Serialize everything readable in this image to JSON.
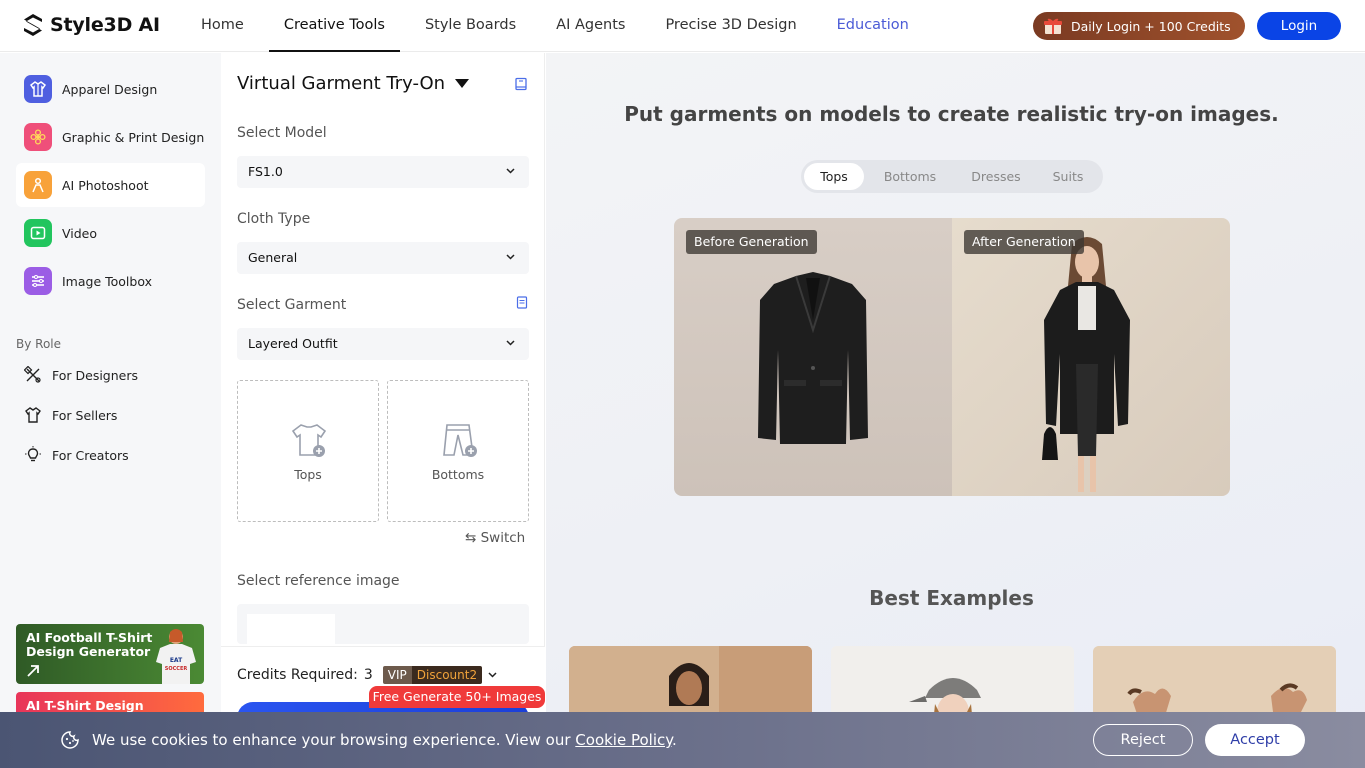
{
  "brand": {
    "name": "Style3D AI"
  },
  "nav": {
    "items": [
      {
        "label": "Home"
      },
      {
        "label": "Creative Tools"
      },
      {
        "label": "Style Boards"
      },
      {
        "label": "AI Agents"
      },
      {
        "label": "Precise 3D Design"
      },
      {
        "label": "Education"
      }
    ],
    "active": "Creative Tools",
    "daily_login": "Daily Login + 100 Credits",
    "login": "Login"
  },
  "sidebar": {
    "items": [
      {
        "label": "Apparel Design",
        "icon": "apparel-icon"
      },
      {
        "label": "Graphic & Print Design",
        "icon": "flower-icon"
      },
      {
        "label": "AI Photoshoot",
        "icon": "person-icon"
      },
      {
        "label": "Video",
        "icon": "video-play-icon"
      },
      {
        "label": "Image Toolbox",
        "icon": "toolbox-icon"
      }
    ],
    "active": "AI Photoshoot",
    "role_heading": "By Role",
    "roles": [
      {
        "label": "For Designers",
        "icon": "design-tools-icon"
      },
      {
        "label": "For Sellers",
        "icon": "shirt-icon"
      },
      {
        "label": "For Creators",
        "icon": "lightbulb-icon"
      }
    ],
    "promos": [
      {
        "label": "AI Football T-Shirt Design Generator",
        "shirt_text": "EAT SLEEP SOCCER REPEAT"
      },
      {
        "label": "AI T-Shirt Design"
      }
    ]
  },
  "panel": {
    "title": "Virtual Garment Try-On",
    "select_model_label": "Select Model",
    "select_model_value": "FS1.0",
    "cloth_type_label": "Cloth Type",
    "cloth_type_value": "General",
    "select_garment_label": "Select Garment",
    "select_garment_value": "Layered Outfit",
    "upload_tops": "Tops",
    "upload_bottoms": "Bottoms",
    "switch": "⇆ Switch",
    "reference_label": "Select reference image",
    "credits_label": "Credits Required:",
    "credits_value": "3",
    "vip": "VIP",
    "discount": "Discount2",
    "free_badge": "Free Generate 50+ Images"
  },
  "main": {
    "headline": "Put garments on models to create realistic try-on images.",
    "tabs": [
      {
        "label": "Tops"
      },
      {
        "label": "Bottoms"
      },
      {
        "label": "Dresses"
      },
      {
        "label": "Suits"
      }
    ],
    "active_tab": "Tops",
    "before_label": "Before Generation",
    "after_label": "After Generation",
    "examples_title": "Best Examples"
  },
  "cookie": {
    "text": "We use cookies to enhance your browsing experience. View our",
    "link": "Cookie Policy",
    "period": ".",
    "reject": "Reject",
    "accept": "Accept"
  },
  "colors": {
    "primary": "#0a44e6",
    "education_link": "#4b5bd6",
    "daily_login_bg": "#8a4528",
    "free_badge": "#f03a3a"
  }
}
